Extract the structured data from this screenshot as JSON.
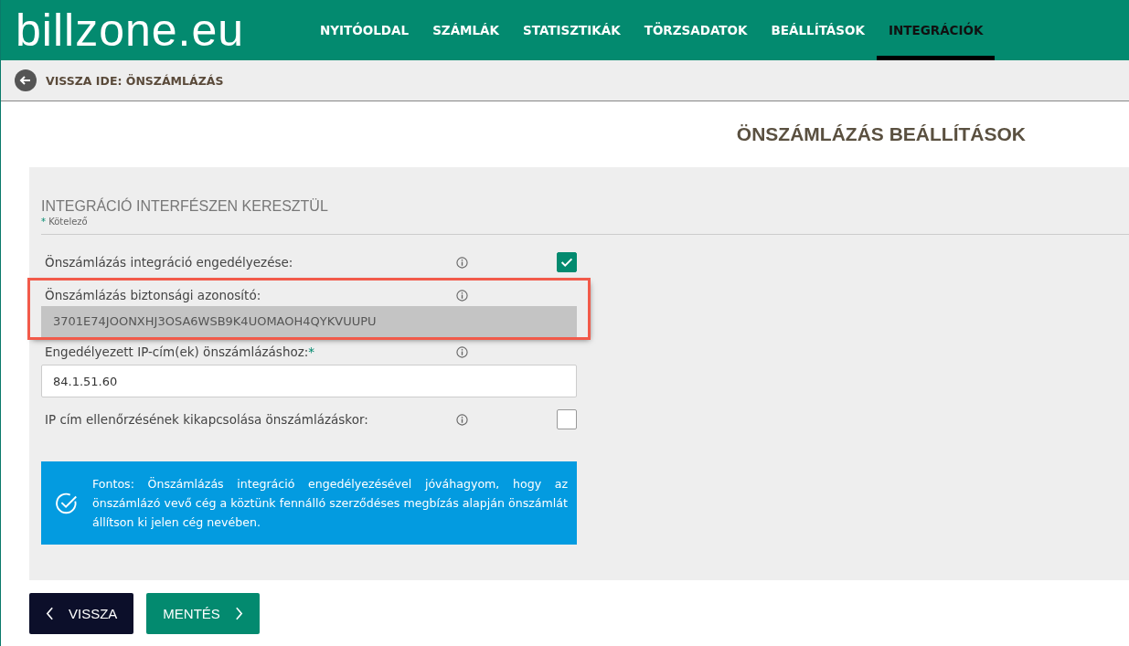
{
  "header": {
    "logo": "billzone.eu",
    "nav": [
      {
        "label": "NYITÓOLDAL",
        "selected": false
      },
      {
        "label": "SZÁMLÁK",
        "selected": false
      },
      {
        "label": "STATISZTIKÁK",
        "selected": false
      },
      {
        "label": "TÖRZSADATOK",
        "selected": false
      },
      {
        "label": "BEÁLLÍTÁSOK",
        "selected": false
      },
      {
        "label": "INTEGRÁCIÓK",
        "selected": true
      }
    ]
  },
  "back_bar": {
    "label": "VISSZA IDE: ÖNSZÁMLÁZÁS"
  },
  "page_title": "ÖNSZÁMLÁZÁS BEÁLLÍTÁSOK",
  "section": {
    "title": "INTEGRÁCIÓ INTERFÉSZEN KERESZTÜL",
    "required_note_mark": "*",
    "required_note": "Kötelező"
  },
  "fields": [
    {
      "kind": "checkbox",
      "label": "Önszámlázás integráció engedélyezése:",
      "checked": true,
      "highlighted": false
    },
    {
      "kind": "readonly",
      "label": "Önszámlázás biztonsági azonosító:",
      "value": "3701E74JOONXHJ3OSA6WSB9K4UOMAOH4QYKVUUPU",
      "highlighted": true
    },
    {
      "kind": "text",
      "label": "Engedélyezett IP-cím(ek) önszámlázáshoz:",
      "required_mark": "*",
      "value": "84.1.51.60",
      "highlighted": false
    },
    {
      "kind": "checkbox",
      "label": "IP cím ellenőrzésének kikapcsolása önszámlázáskor:",
      "checked": false,
      "highlighted": false
    }
  ],
  "notice": "Fontos: Önszámlázás integráció engedélyezésével jóváhagyom, hogy az önszámlázó vevő cég a köztünk fennálló szerződéses megbízás alapján önszámlát állítson ki jelen cég nevében.",
  "buttons": [
    {
      "kind": "back",
      "label": "VISSZA"
    },
    {
      "kind": "save",
      "label": "MENTÉS"
    }
  ]
}
